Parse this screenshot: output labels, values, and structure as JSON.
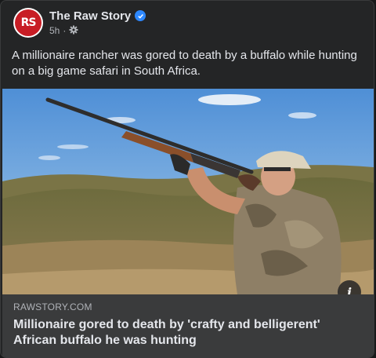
{
  "post": {
    "page_name": "The Raw Story",
    "time": "5h",
    "text": "A millionaire rancher was gored to death by a buffalo while hunting on a big game safari in South Africa.",
    "avatar_letters": "RS"
  },
  "link_preview": {
    "domain": "RAWSTORY.COM",
    "headline": "Millionaire gored to death by 'crafty and belligerent' African buffalo he was hunting"
  },
  "icons": {
    "verified": "verified-badge-icon",
    "audience": "gear-icon",
    "info": "info-icon"
  },
  "colors": {
    "brand_red": "#c81d25",
    "verified_blue": "#2d88ff",
    "card_bg": "#242526",
    "link_bg": "#3a3b3c"
  }
}
